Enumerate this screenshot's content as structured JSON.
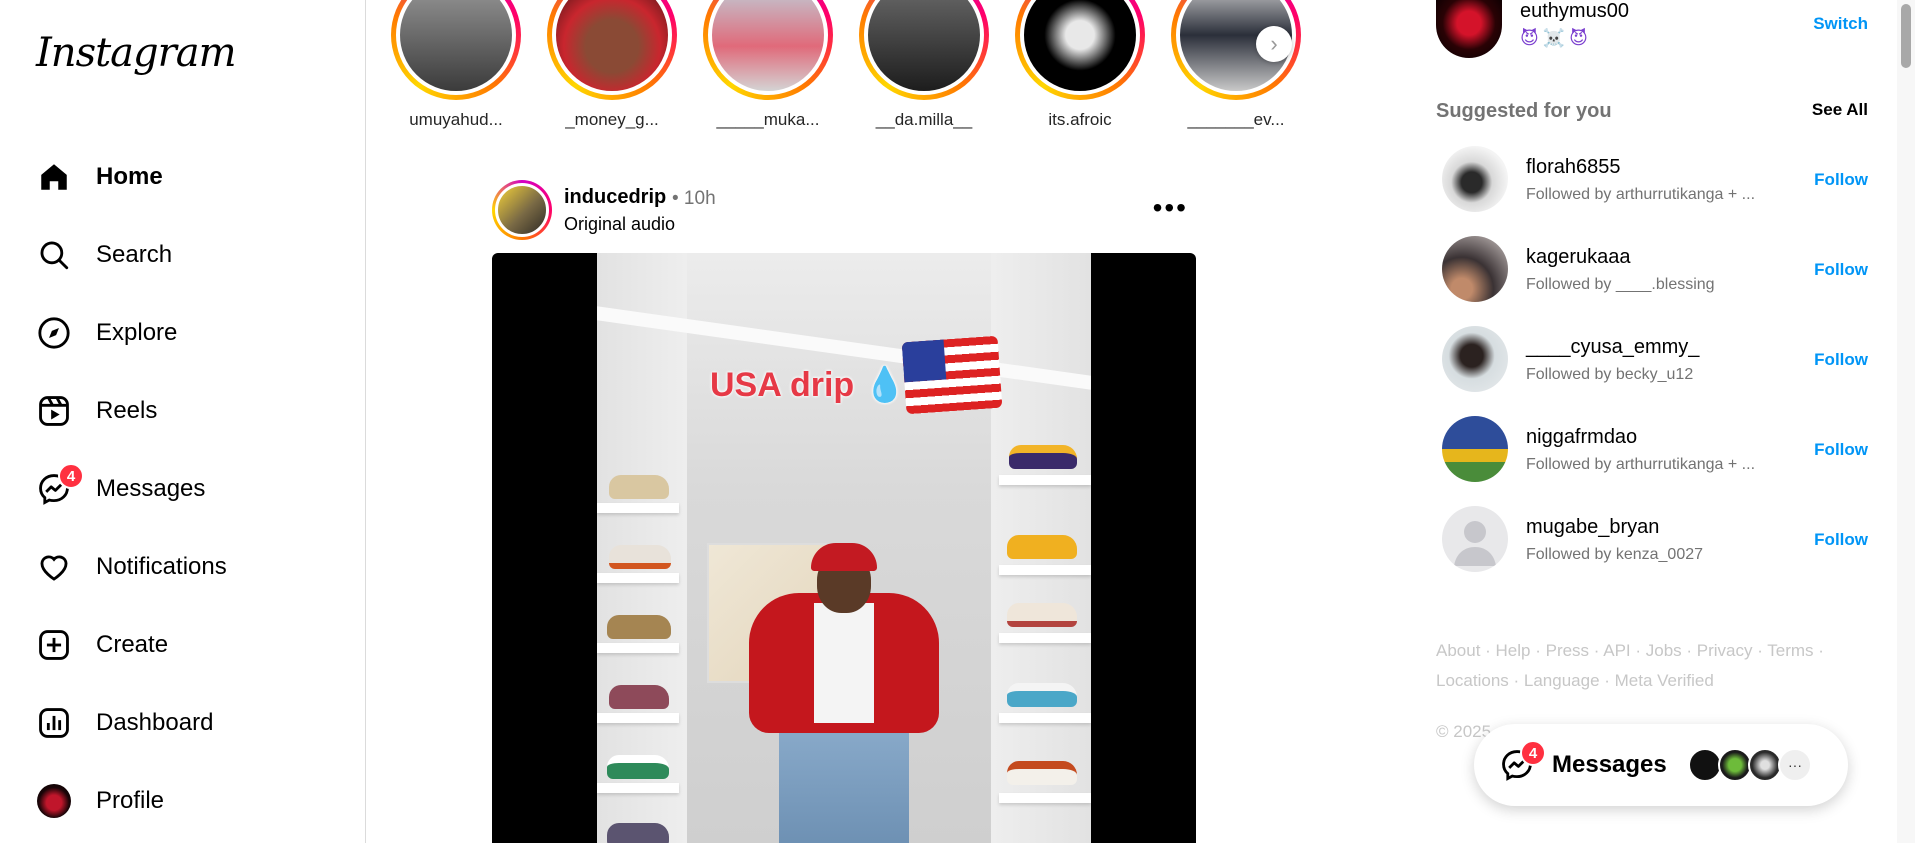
{
  "app": {
    "logo": "Instagram"
  },
  "sidebar": {
    "items": [
      {
        "label": "Home",
        "icon": "home-icon",
        "active": true
      },
      {
        "label": "Search",
        "icon": "search-icon"
      },
      {
        "label": "Explore",
        "icon": "compass-icon"
      },
      {
        "label": "Reels",
        "icon": "reels-icon"
      },
      {
        "label": "Messages",
        "icon": "messenger-icon",
        "badge": "4"
      },
      {
        "label": "Notifications",
        "icon": "heart-icon"
      },
      {
        "label": "Create",
        "icon": "plus-square-icon"
      },
      {
        "label": "Dashboard",
        "icon": "dashboard-icon"
      },
      {
        "label": "Profile",
        "icon": "avatar"
      }
    ]
  },
  "stories": [
    {
      "name": "umuyahud..."
    },
    {
      "name": "_money_g..."
    },
    {
      "name": "_____muka..."
    },
    {
      "name": "__da.milla__"
    },
    {
      "name": "its.afroic"
    },
    {
      "name": "_______ev..."
    }
  ],
  "post": {
    "username": "inducedrip",
    "time": "• 10h",
    "audio": "Original audio",
    "more": "•••",
    "overlay_text": "USA drip 💧"
  },
  "account": {
    "username": "euthymus00",
    "emoji": "😈☠️😈",
    "switch_label": "Switch"
  },
  "suggested": {
    "title": "Suggested for you",
    "see_all": "See All",
    "follow_label": "Follow",
    "items": [
      {
        "username": "florah6855",
        "sub": "Followed by arthurrutikanga + ..."
      },
      {
        "username": "kagerukaaa",
        "sub": "Followed by ____.blessing"
      },
      {
        "username": "____cyusa_emmy_",
        "sub": "Followed by becky_u12"
      },
      {
        "username": "niggafrmdao",
        "sub": "Followed by arthurrutikanga + ..."
      },
      {
        "username": "mugabe_bryan",
        "sub": "Followed by kenza_0027"
      }
    ]
  },
  "footer": {
    "links_line1": "About · Help · Press · API · Jobs · Privacy · Terms ·",
    "links_line2": "Locations · Language · Meta Verified",
    "copyright": "© 2025"
  },
  "messages_pill": {
    "label": "Messages",
    "badge": "4",
    "more": "···"
  },
  "colors": {
    "accent": "#0095f6",
    "badge": "#ff3040",
    "muted": "#737373"
  }
}
